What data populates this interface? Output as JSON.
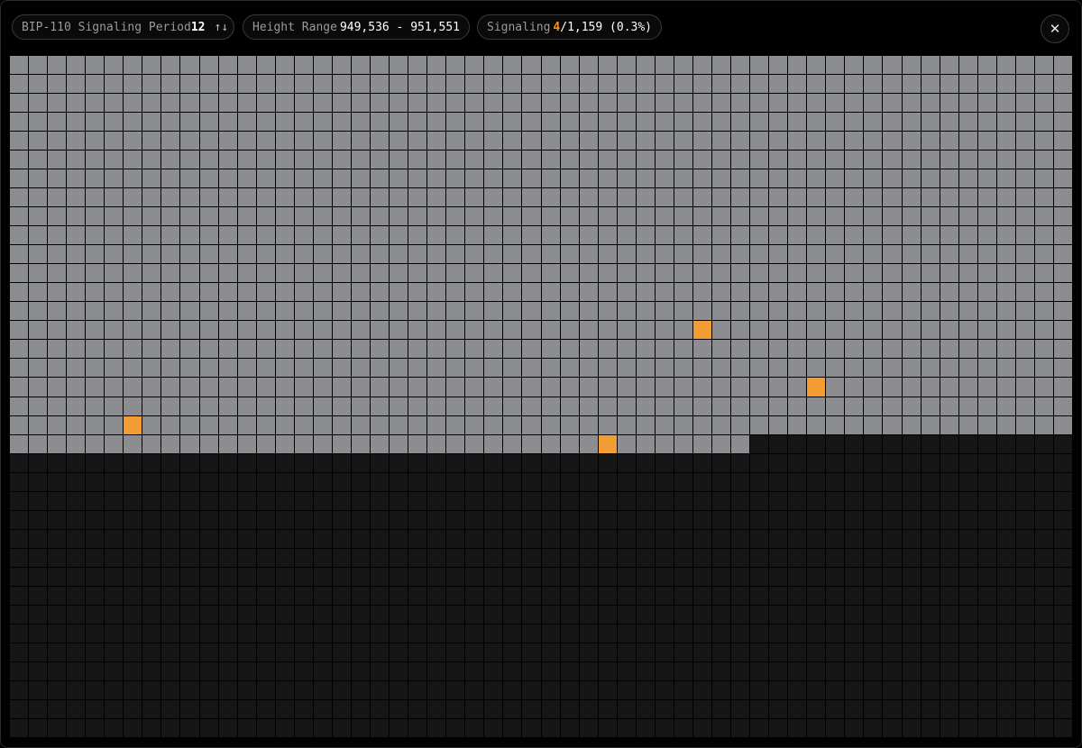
{
  "header": {
    "period_label": "BIP-110 Signaling Period",
    "period_value": "12",
    "sort_icon": "sort-arrows-icon",
    "height_label": "Height Range",
    "height_value": "949,536 - 951,551",
    "signal_label": "Signaling",
    "signal_count": "4",
    "signal_rest": "/1,159 (0.3%)",
    "close_icon": "close-icon"
  },
  "grid": {
    "columns": 56,
    "rows": 36,
    "total_blocks": 2016,
    "mined_blocks": 1159,
    "signaling_blocks": [
      {
        "row": 14,
        "col": 36
      },
      {
        "row": 17,
        "col": 42
      },
      {
        "row": 19,
        "col": 6
      },
      {
        "row": 20,
        "col": 31
      }
    ],
    "colors": {
      "mined": "#8b8d90",
      "signaling": "#f39c33",
      "pending": "#161616"
    }
  }
}
